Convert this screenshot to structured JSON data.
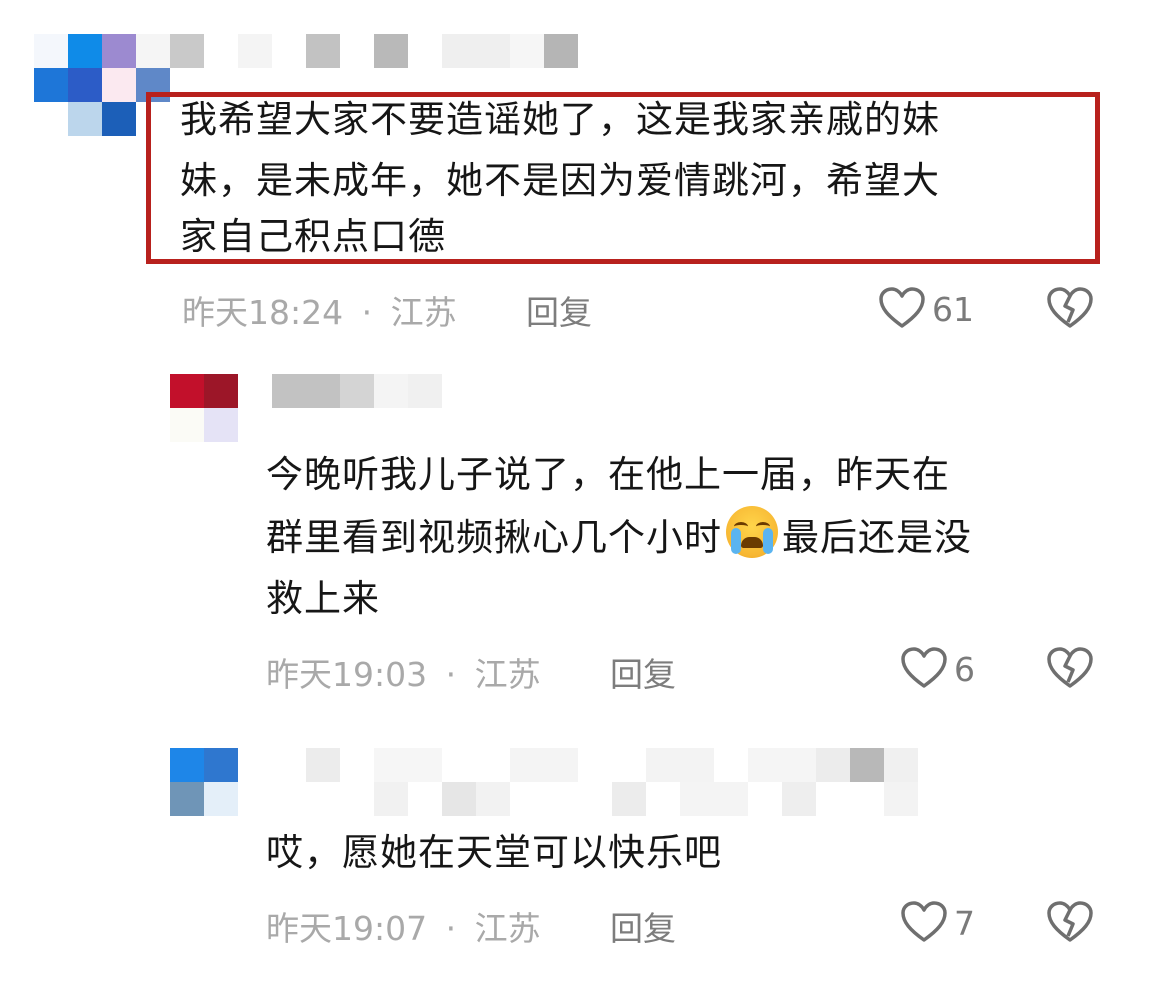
{
  "comments": [
    {
      "text_lines": [
        "我希望大家不要造谣她了，这是我家亲戚的妹",
        "妹，是未成年，她不是因为爱情跳河，希望大",
        "家自己积点口德"
      ],
      "time": "昨天18:24",
      "location": "江苏",
      "reply_label": "回复",
      "likes": "61"
    },
    {
      "text_lines": [
        "今晚听我儿子说了，在他上一届，昨天在",
        "群里看到视频揪心几个小时",
        "最后还是没",
        "救上来"
      ],
      "time": "昨天19:03",
      "location": "江苏",
      "reply_label": "回复",
      "likes": "6"
    },
    {
      "text_lines": [
        "哎，愿她在天堂可以快乐吧"
      ],
      "time": "昨天19:07",
      "location": "江苏",
      "reply_label": "回复",
      "likes": "7"
    }
  ],
  "separator": "·",
  "icons": {
    "like": "heart-outline-icon",
    "dislike": "broken-heart-icon",
    "emoji": "loudly-crying-face-emoji"
  },
  "colors": {
    "highlight_border": "#b8211d",
    "meta_text": "#a9a9a9"
  }
}
